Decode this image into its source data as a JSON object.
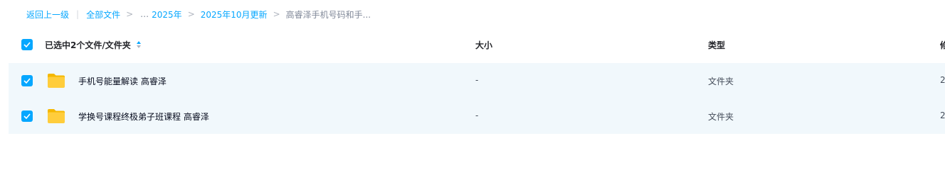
{
  "breadcrumb": {
    "back": "返回上一级",
    "separator_bar": "|",
    "all_files": "全部文件",
    "gt": ">",
    "ellipsis": "…",
    "level1": "2025年",
    "level2": "2025年10月更新",
    "current": "高睿泽手机号码和手..."
  },
  "table": {
    "headers": {
      "selection": "已选中2个文件/文件夹",
      "size": "大小",
      "type": "类型",
      "modified_partial": "修"
    },
    "rows": [
      {
        "name": "手机号能量解读 高睿泽",
        "size": "-",
        "type": "文件夹",
        "date_partial": "2"
      },
      {
        "name": "学换号课程终极弟子班课程 高睿泽",
        "size": "-",
        "type": "文件夹",
        "date_partial": "2"
      }
    ]
  },
  "colors": {
    "accent": "#06a7ff",
    "row_selected_bg": "#f1f8fc",
    "folder": "#ffcd3c"
  },
  "icons": [
    "check-icon",
    "sort-icon",
    "folder-icon"
  ]
}
